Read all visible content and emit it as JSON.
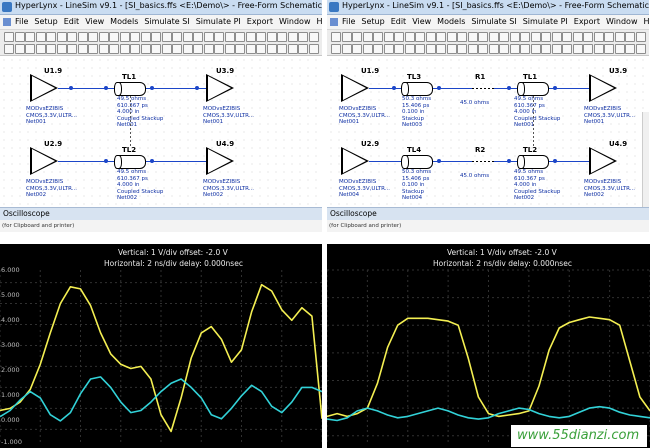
{
  "left": {
    "title": "HyperLynx - LineSim v9.1 - [SI_basics.ffs <E:\\Demo\\> - Free-Form Schematic Editor]",
    "menu": [
      "File",
      "Setup",
      "Edit",
      "View",
      "Models",
      "Simulate SI",
      "Simulate PI",
      "Export",
      "Window",
      "Help"
    ],
    "schematic": {
      "u1": {
        "name": "U1.9",
        "l1": "MODvsEZIBIS",
        "l2": "CMOS,3.3V,ULTR...",
        "net": "Net001"
      },
      "u3": {
        "name": "U3.9",
        "l1": "MODvsEZIBIS",
        "l2": "CMOS,3.3V,ULTR...",
        "net": "Net001"
      },
      "u2": {
        "name": "U2.9",
        "l1": "MODvsEZIBIS",
        "l2": "CMOS,3.3V,ULTR...",
        "net": "Net002"
      },
      "u4": {
        "name": "U4.9",
        "l1": "MODvsEZIBIS",
        "l2": "CMOS,3.3V,ULTR...",
        "net": "Net002"
      },
      "tl1": {
        "name": "TL1",
        "l1": "49.5 ohms",
        "l2": "610.367 ps",
        "l3": "4.000 in",
        "l4": "Coupled Stackup",
        "net": "Net001"
      },
      "tl2": {
        "name": "TL2",
        "l1": "49.5 ohms",
        "l2": "610.367 ps",
        "l3": "4.000 in",
        "l4": "Coupled Stackup",
        "net": "Net002"
      }
    },
    "oscilloscope_title": "Oscilloscope",
    "clip_text": "(for Clipboard and printer)",
    "scope": {
      "vertical": "Vertical: 1  V/div  offset: -2.0 V",
      "horizontal": "Horizontal: 2 ns/div  delay: 0.000nsec",
      "y_labels": [
        "6.000",
        "5.000",
        "4.000",
        "3.000",
        "2.000",
        "1.000",
        "0.000",
        "-1.000"
      ]
    }
  },
  "right": {
    "title": "HyperLynx - LineSim v9.1 - [SI_basics.ffs <E:\\Demo\\> - Free-Form Schematic Editor]",
    "menu": [
      "File",
      "Setup",
      "Edit",
      "View",
      "Models",
      "Simulate SI",
      "Simulate PI",
      "Export",
      "Window",
      "Help"
    ],
    "schematic": {
      "u1": {
        "name": "U1.9",
        "l1": "MODvsEZIBIS",
        "l2": "CMOS,3.3V,ULTR...",
        "net": "Net001"
      },
      "u3": {
        "name": "U3.9",
        "l1": "MODvsEZIBIS",
        "l2": "CMOS,3.3V,ULTR...",
        "net": "Net001"
      },
      "u2": {
        "name": "U2.9",
        "l1": "MODvsEZIBIS",
        "l2": "CMOS,3.3V,ULTR...",
        "net": "Net004"
      },
      "u4": {
        "name": "U4.9",
        "l1": "MODvsEZIBIS",
        "l2": "CMOS,3.3V,ULTR...",
        "net": "Net002"
      },
      "tl3": {
        "name": "TL3",
        "l1": "50.3 ohms",
        "l2": "15.406 ps",
        "l3": "0.100 in",
        "l4": "Stackup",
        "net": "Net003"
      },
      "tl4": {
        "name": "TL4",
        "l1": "50.3 ohms",
        "l2": "15.406 ps",
        "l3": "0.100 in",
        "l4": "Stackup",
        "net": "Net004"
      },
      "r1": {
        "name": "R1",
        "value": "45.0 ohms"
      },
      "r2": {
        "name": "R2",
        "value": "45.0 ohms"
      },
      "tl1": {
        "name": "TL1",
        "l1": "49.5 ohms",
        "l2": "610.367 ps",
        "l3": "4.000 in",
        "l4": "Coupled Stackup",
        "net": "Net001"
      },
      "tl2": {
        "name": "TL2",
        "l1": "49.5 ohms",
        "l2": "610.367 ps",
        "l3": "4.000 in",
        "l4": "Coupled Stackup",
        "net": "Net002"
      }
    },
    "oscilloscope_title": "Oscilloscope",
    "clip_text": "(for Clipboard and printer)",
    "scope": {
      "vertical": "Vertical: 1  V/div  offset: -2.0 V",
      "horizontal": "Horizontal: 2 ns/div  delay: 0.000nsec"
    }
  },
  "watermark": "www.55dianzi.com",
  "colors": {
    "signal_yellow": "#f4ef52",
    "signal_cyan": "#32d2d8",
    "scope_bg": "#000000",
    "net": "#1c46c8"
  },
  "chart_data": [
    {
      "type": "line",
      "ylim": [
        -1.7,
        6.6
      ],
      "x": [
        0.0,
        0.5,
        1.0,
        1.5,
        2.0,
        2.5,
        3.0,
        3.5,
        4.0,
        4.5,
        5.0,
        5.5,
        6.0,
        6.5,
        7.0,
        7.5,
        8.0,
        8.5,
        9.0,
        9.5,
        10.0,
        10.5,
        11.0,
        11.5,
        12.0,
        12.5,
        13.0,
        13.5,
        14.0,
        14.5,
        15.0,
        15.5,
        16.0
      ],
      "series": [
        {
          "color": "#f4ef52",
          "values": [
            -0.1,
            0.0,
            0.3,
            0.9,
            2.1,
            3.6,
            5.0,
            5.8,
            5.7,
            4.9,
            3.6,
            2.6,
            2.1,
            1.9,
            2.0,
            1.4,
            -0.3,
            -1.1,
            0.5,
            2.4,
            3.6,
            3.9,
            3.3,
            2.2,
            2.8,
            4.6,
            5.9,
            5.6,
            4.7,
            4.2,
            4.8,
            4.4,
            -0.5
          ]
        },
        {
          "color": "#32d2d8",
          "values": [
            -0.4,
            -0.1,
            0.4,
            0.8,
            0.5,
            -0.3,
            -0.6,
            -0.2,
            0.7,
            1.4,
            1.5,
            1.0,
            0.3,
            -0.2,
            -0.1,
            0.3,
            0.8,
            1.2,
            1.4,
            1.0,
            0.5,
            -0.3,
            -0.5,
            0.0,
            0.6,
            1.1,
            0.8,
            0.1,
            -0.2,
            0.3,
            1.0,
            1.0,
            0.8
          ]
        }
      ]
    },
    {
      "type": "line",
      "ylim": [
        -1.3,
        5.0
      ],
      "x": [
        0.0,
        0.5,
        1.0,
        1.5,
        2.0,
        2.5,
        3.0,
        3.5,
        4.0,
        4.5,
        5.0,
        5.5,
        6.0,
        6.5,
        7.0,
        7.5,
        8.0,
        8.5,
        9.0,
        9.5,
        10.0,
        10.5,
        11.0,
        11.5,
        12.0,
        12.5,
        13.0,
        13.5,
        14.0,
        14.5,
        15.0,
        15.5,
        16.0
      ],
      "series": [
        {
          "color": "#f4ef52",
          "values": [
            -0.3,
            -0.2,
            -0.3,
            -0.2,
            0.0,
            0.9,
            2.2,
            3.0,
            3.25,
            3.25,
            3.25,
            3.2,
            3.15,
            3.0,
            1.8,
            0.4,
            -0.2,
            -0.3,
            -0.25,
            -0.2,
            -0.1,
            0.8,
            2.1,
            2.9,
            3.1,
            3.2,
            3.3,
            3.25,
            3.2,
            3.0,
            1.7,
            0.4,
            -0.1
          ]
        },
        {
          "color": "#32d2d8",
          "values": [
            -0.4,
            -0.45,
            -0.35,
            -0.1,
            0.0,
            -0.1,
            -0.25,
            -0.35,
            -0.3,
            -0.2,
            -0.1,
            0.0,
            -0.1,
            -0.25,
            -0.35,
            -0.4,
            -0.35,
            -0.2,
            -0.1,
            0.0,
            -0.05,
            -0.2,
            -0.3,
            -0.35,
            -0.3,
            -0.15,
            0.0,
            0.05,
            0.0,
            -0.15,
            -0.25,
            -0.3,
            -0.35
          ]
        }
      ]
    }
  ]
}
